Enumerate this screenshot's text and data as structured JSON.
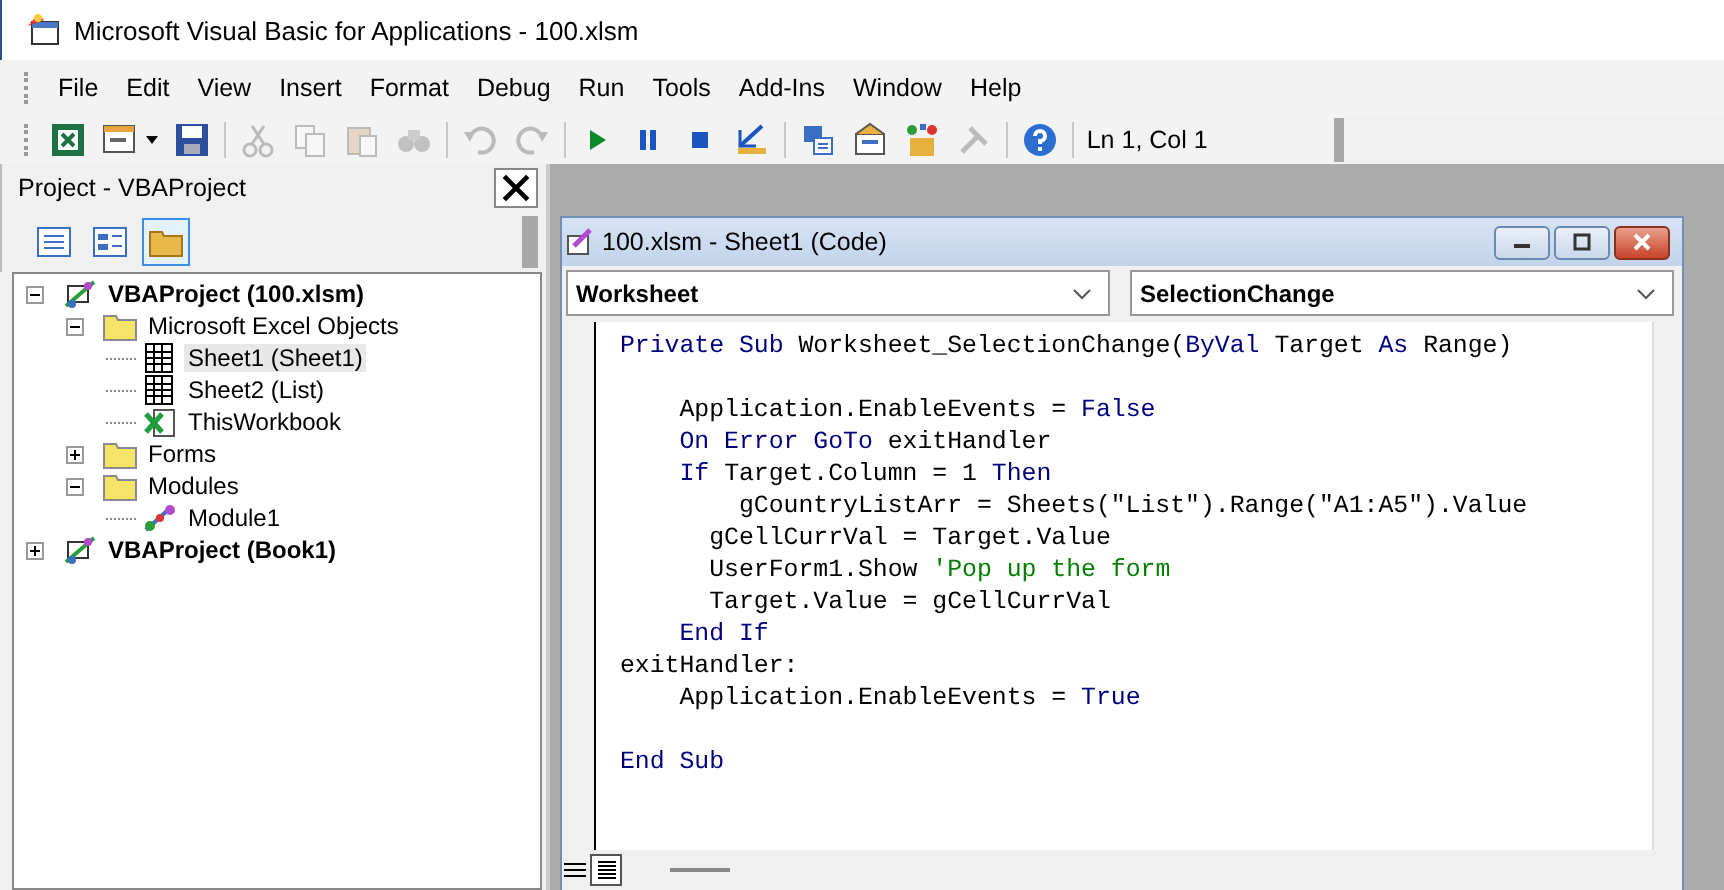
{
  "window": {
    "title": "Microsoft Visual Basic for Applications - 100.xlsm"
  },
  "menu": [
    "File",
    "Edit",
    "View",
    "Insert",
    "Format",
    "Debug",
    "Run",
    "Tools",
    "Add-Ins",
    "Window",
    "Help"
  ],
  "toolbar": [
    {
      "kind": "excel",
      "disabled": false
    },
    {
      "kind": "insert-form",
      "disabled": false
    },
    {
      "kind": "save",
      "disabled": false
    },
    {
      "kind": "separator"
    },
    {
      "kind": "cut",
      "disabled": true
    },
    {
      "kind": "copy",
      "disabled": true
    },
    {
      "kind": "paste",
      "disabled": true
    },
    {
      "kind": "find",
      "disabled": true
    },
    {
      "kind": "separator"
    },
    {
      "kind": "undo",
      "disabled": true
    },
    {
      "kind": "redo",
      "disabled": true
    },
    {
      "kind": "separator"
    },
    {
      "kind": "run",
      "disabled": false
    },
    {
      "kind": "pause",
      "disabled": false
    },
    {
      "kind": "stop",
      "disabled": false
    },
    {
      "kind": "design",
      "disabled": false
    },
    {
      "kind": "separator"
    },
    {
      "kind": "project",
      "disabled": false
    },
    {
      "kind": "properties",
      "disabled": false
    },
    {
      "kind": "browser",
      "disabled": false
    },
    {
      "kind": "toolbox",
      "disabled": true
    },
    {
      "kind": "separator"
    },
    {
      "kind": "help",
      "disabled": false
    }
  ],
  "cursor_position": "Ln 1, Col 1",
  "project_panel": {
    "title": "Project - VBAProject",
    "buttons": [
      {
        "kind": "view-code",
        "selected": false
      },
      {
        "kind": "view-object",
        "selected": false
      },
      {
        "kind": "toggle-folders",
        "selected": true
      }
    ],
    "tree": [
      {
        "label": "VBAProject (100.xlsm)",
        "kind": "project",
        "expanded": true,
        "selected": false,
        "children": [
          {
            "label": "Microsoft Excel Objects",
            "kind": "folder",
            "expanded": true,
            "selected": false,
            "children": [
              {
                "label": "Sheet1 (Sheet1)",
                "kind": "sheet",
                "selected": true
              },
              {
                "label": "Sheet2 (List)",
                "kind": "sheet",
                "selected": false
              },
              {
                "label": "ThisWorkbook",
                "kind": "workbook",
                "selected": false
              }
            ]
          },
          {
            "label": "Forms",
            "kind": "folder",
            "expanded": false,
            "selected": false
          },
          {
            "label": "Modules",
            "kind": "folder",
            "expanded": true,
            "selected": false,
            "children": [
              {
                "label": "Module1",
                "kind": "module",
                "selected": false
              }
            ]
          }
        ]
      },
      {
        "label": "VBAProject (Book1)",
        "kind": "project",
        "expanded": false,
        "selected": false
      }
    ]
  },
  "code_window": {
    "title": "100.xlsm - Sheet1 (Code)",
    "object": "Worksheet",
    "procedure": "SelectionChange",
    "lines": [
      [
        {
          "kind": "keyword",
          "text": "Private Sub "
        },
        {
          "kind": "plain",
          "text": "Worksheet_SelectionChange("
        },
        {
          "kind": "keyword",
          "text": "ByVal "
        },
        {
          "kind": "plain",
          "text": "Target "
        },
        {
          "kind": "keyword",
          "text": "As "
        },
        {
          "kind": "plain",
          "text": "Range)"
        }
      ],
      [
        {
          "kind": "blank"
        }
      ],
      [
        {
          "kind": "plain",
          "text": "    Application.EnableEvents = "
        },
        {
          "kind": "keyword",
          "text": "False"
        }
      ],
      [
        {
          "kind": "keyword",
          "text": "    On Error GoTo "
        },
        {
          "kind": "plain",
          "text": "exitHandler"
        }
      ],
      [
        {
          "kind": "keyword",
          "text": "    If "
        },
        {
          "kind": "plain",
          "text": "Target.Column = 1 "
        },
        {
          "kind": "keyword",
          "text": "Then"
        }
      ],
      [
        {
          "kind": "plain",
          "text": "        gCountryListArr = Sheets(\"List\").Range(\"A1:A5\").Value"
        }
      ],
      [
        {
          "kind": "plain",
          "text": "      gCellCurrVal = Target.Value"
        }
      ],
      [
        {
          "kind": "plain",
          "text": "      UserForm1.Show "
        },
        {
          "kind": "comment",
          "text": "'Pop up the form"
        }
      ],
      [
        {
          "kind": "plain",
          "text": "      Target.Value = gCellCurrVal"
        }
      ],
      [
        {
          "kind": "keyword",
          "text": "    End If"
        }
      ],
      [
        {
          "kind": "plain",
          "text": "exitHandler:"
        }
      ],
      [
        {
          "kind": "plain",
          "text": "    Application.EnableEvents = "
        },
        {
          "kind": "keyword",
          "text": "True"
        }
      ],
      [
        {
          "kind": "blank"
        }
      ],
      [
        {
          "kind": "keyword",
          "text": "End Sub"
        }
      ]
    ]
  }
}
